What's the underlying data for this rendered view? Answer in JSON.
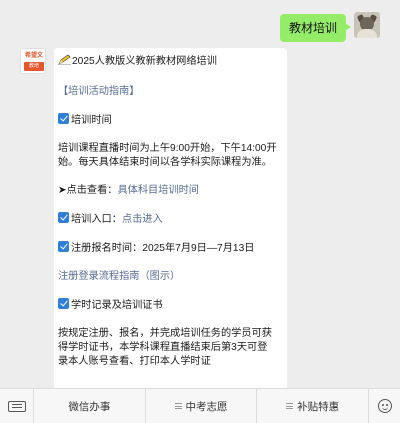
{
  "outgoing": {
    "text": "教材培训"
  },
  "incoming": {
    "avatar": {
      "logo_text": "希望文",
      "badge": "教培"
    },
    "title": "2025人教版义教新教材网络培训",
    "guide_link": "【培训活动指南】",
    "time_heading": "培训时间",
    "time_text": "培训课程直播时间为上午9:00开始，下午14:00开始。每天具体结束时间以各学科实际课程为准。",
    "click_prefix": "➤点击查看：",
    "click_link": "具体科目培训时间",
    "entry_label": "培训入口：",
    "entry_link": "点击进入",
    "register_text": "注册报名时间：2025年7月9日—7月13日",
    "login_link": "注册登录流程指南（图示）",
    "cert_heading": "学时记录及培训证书",
    "cert_text": "按规定注册、报名，并完成培训任务的学员可获得学时证书，本学科课程直播结束后第3天可登录本人账号查看、打印本人学时证"
  },
  "menubar": {
    "items": [
      "微信办事",
      "中考志愿",
      "补贴特惠"
    ]
  },
  "colors": {
    "out_bubble": "#95ec69",
    "link": "#576b95",
    "checkbox": "#2f7fd9"
  }
}
